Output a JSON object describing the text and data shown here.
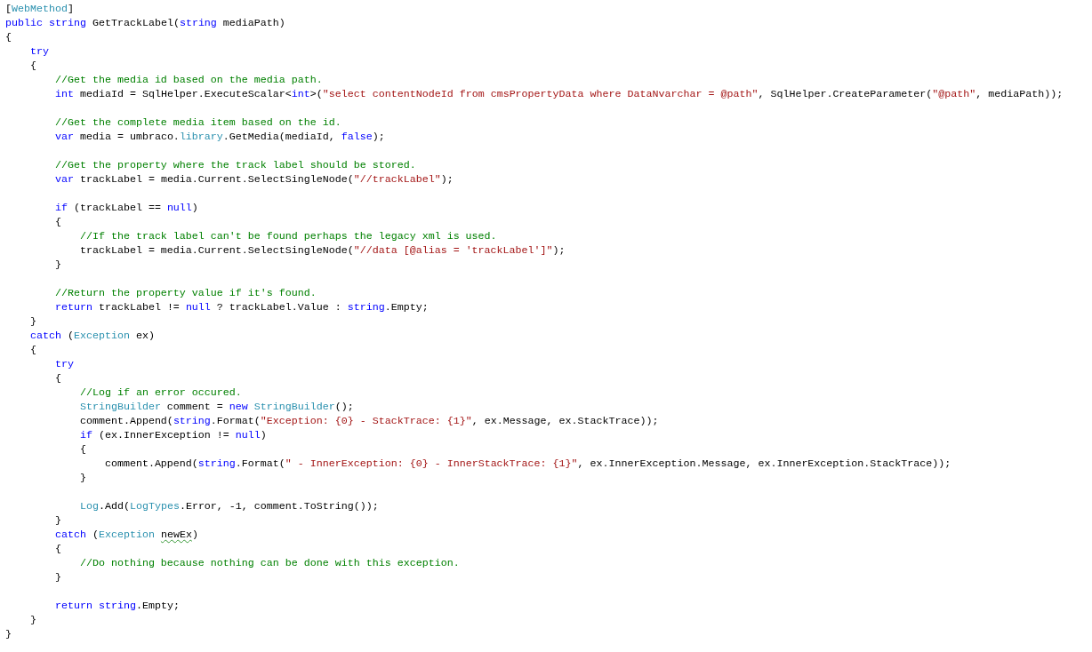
{
  "editor": {
    "lines": [
      {
        "kind": "code",
        "tokens": [
          {
            "text": "[",
            "kind": "plain"
          },
          {
            "text": "WebMethod",
            "kind": "type"
          },
          {
            "text": "]",
            "kind": "plain"
          }
        ]
      },
      {
        "kind": "code",
        "tokens": [
          {
            "text": "public",
            "kind": "keyword"
          },
          {
            "text": " string",
            "kind": "keyword"
          },
          {
            "text": " GetTrackLabel(",
            "kind": "plain"
          },
          {
            "text": "string",
            "kind": "keyword"
          },
          {
            "text": " mediaPath)",
            "kind": "plain"
          }
        ]
      },
      {
        "kind": "code",
        "tokens": [
          {
            "text": "{",
            "kind": "plain"
          }
        ]
      },
      {
        "kind": "code",
        "tokens": [
          {
            "text": "    try",
            "kind": "keyword"
          }
        ]
      },
      {
        "kind": "code",
        "tokens": [
          {
            "text": "    {",
            "kind": "plain"
          }
        ]
      },
      {
        "kind": "code",
        "tokens": [
          {
            "text": "        //Get the media id based on the media path.",
            "kind": "comment"
          }
        ]
      },
      {
        "kind": "code",
        "tokens": [
          {
            "text": "        int",
            "kind": "keyword"
          },
          {
            "text": " mediaId = SqlHelper.ExecuteScalar<",
            "kind": "plain"
          },
          {
            "text": "int",
            "kind": "keyword"
          },
          {
            "text": ">(",
            "kind": "plain"
          },
          {
            "text": "\"select contentNodeId from cmsPropertyData where DataNvarchar = @path\"",
            "kind": "string"
          },
          {
            "text": ", SqlHelper.CreateParameter(",
            "kind": "plain"
          },
          {
            "text": "\"@path\"",
            "kind": "string"
          },
          {
            "text": ", mediaPath));",
            "kind": "plain"
          }
        ]
      },
      {
        "kind": "blank"
      },
      {
        "kind": "code",
        "tokens": [
          {
            "text": "        //Get the complete media item based on the id.",
            "kind": "comment"
          }
        ]
      },
      {
        "kind": "code",
        "tokens": [
          {
            "text": "        var",
            "kind": "keyword"
          },
          {
            "text": " media = umbraco.",
            "kind": "plain"
          },
          {
            "text": "library",
            "kind": "type"
          },
          {
            "text": ".GetMedia(mediaId, ",
            "kind": "plain"
          },
          {
            "text": "false",
            "kind": "keyword"
          },
          {
            "text": ");",
            "kind": "plain"
          }
        ]
      },
      {
        "kind": "blank"
      },
      {
        "kind": "code",
        "tokens": [
          {
            "text": "        //Get the property where the track label should be stored.",
            "kind": "comment"
          }
        ]
      },
      {
        "kind": "code",
        "tokens": [
          {
            "text": "        var",
            "kind": "keyword"
          },
          {
            "text": " trackLabel = media.Current.SelectSingleNode(",
            "kind": "plain"
          },
          {
            "text": "\"//trackLabel\"",
            "kind": "string"
          },
          {
            "text": ");",
            "kind": "plain"
          }
        ]
      },
      {
        "kind": "blank"
      },
      {
        "kind": "code",
        "tokens": [
          {
            "text": "        if",
            "kind": "keyword"
          },
          {
            "text": " (trackLabel == ",
            "kind": "plain"
          },
          {
            "text": "null",
            "kind": "keyword"
          },
          {
            "text": ")",
            "kind": "plain"
          }
        ]
      },
      {
        "kind": "code",
        "tokens": [
          {
            "text": "        {",
            "kind": "plain"
          }
        ]
      },
      {
        "kind": "code",
        "tokens": [
          {
            "text": "            //If the track label can't be found perhaps the legacy xml is used.",
            "kind": "comment"
          }
        ]
      },
      {
        "kind": "code",
        "tokens": [
          {
            "text": "            trackLabel = media.Current.SelectSingleNode(",
            "kind": "plain"
          },
          {
            "text": "\"//data [@alias = 'trackLabel']\"",
            "kind": "string"
          },
          {
            "text": ");",
            "kind": "plain"
          }
        ]
      },
      {
        "kind": "code",
        "tokens": [
          {
            "text": "        }",
            "kind": "plain"
          }
        ]
      },
      {
        "kind": "blank"
      },
      {
        "kind": "code",
        "tokens": [
          {
            "text": "        //Return the property value if it's found.",
            "kind": "comment"
          }
        ]
      },
      {
        "kind": "code",
        "tokens": [
          {
            "text": "        return",
            "kind": "keyword"
          },
          {
            "text": " trackLabel != ",
            "kind": "plain"
          },
          {
            "text": "null",
            "kind": "keyword"
          },
          {
            "text": " ? trackLabel.Value : ",
            "kind": "plain"
          },
          {
            "text": "string",
            "kind": "keyword"
          },
          {
            "text": ".Empty;",
            "kind": "plain"
          }
        ]
      },
      {
        "kind": "code",
        "tokens": [
          {
            "text": "    }",
            "kind": "plain"
          }
        ]
      },
      {
        "kind": "code",
        "tokens": [
          {
            "text": "    catch",
            "kind": "keyword"
          },
          {
            "text": " (",
            "kind": "plain"
          },
          {
            "text": "Exception",
            "kind": "type"
          },
          {
            "text": " ex)",
            "kind": "plain"
          }
        ]
      },
      {
        "kind": "code",
        "tokens": [
          {
            "text": "    {",
            "kind": "plain"
          }
        ]
      },
      {
        "kind": "code",
        "tokens": [
          {
            "text": "        try",
            "kind": "keyword"
          }
        ]
      },
      {
        "kind": "code",
        "tokens": [
          {
            "text": "        {",
            "kind": "plain"
          }
        ]
      },
      {
        "kind": "code",
        "tokens": [
          {
            "text": "            //Log if an error occured.",
            "kind": "comment"
          }
        ]
      },
      {
        "kind": "code",
        "tokens": [
          {
            "text": "            StringBuilder",
            "kind": "type"
          },
          {
            "text": " comment = ",
            "kind": "plain"
          },
          {
            "text": "new",
            "kind": "keyword"
          },
          {
            "text": " StringBuilder",
            "kind": "type"
          },
          {
            "text": "();",
            "kind": "plain"
          }
        ]
      },
      {
        "kind": "code",
        "tokens": [
          {
            "text": "            comment.Append(",
            "kind": "plain"
          },
          {
            "text": "string",
            "kind": "keyword"
          },
          {
            "text": ".Format(",
            "kind": "plain"
          },
          {
            "text": "\"Exception: {0} - StackTrace: {1}\"",
            "kind": "string"
          },
          {
            "text": ", ex.Message, ex.StackTrace));",
            "kind": "plain"
          }
        ]
      },
      {
        "kind": "code",
        "tokens": [
          {
            "text": "            if",
            "kind": "keyword"
          },
          {
            "text": " (ex.InnerException != ",
            "kind": "plain"
          },
          {
            "text": "null",
            "kind": "keyword"
          },
          {
            "text": ")",
            "kind": "plain"
          }
        ]
      },
      {
        "kind": "code",
        "tokens": [
          {
            "text": "            {",
            "kind": "plain"
          }
        ]
      },
      {
        "kind": "code",
        "tokens": [
          {
            "text": "                comment.Append(",
            "kind": "plain"
          },
          {
            "text": "string",
            "kind": "keyword"
          },
          {
            "text": ".Format(",
            "kind": "plain"
          },
          {
            "text": "\" - InnerException: {0} - InnerStackTrace: {1}\"",
            "kind": "string"
          },
          {
            "text": ", ex.InnerException.Message, ex.InnerException.StackTrace));",
            "kind": "plain"
          }
        ]
      },
      {
        "kind": "code",
        "tokens": [
          {
            "text": "            }",
            "kind": "plain"
          }
        ]
      },
      {
        "kind": "blank"
      },
      {
        "kind": "code",
        "tokens": [
          {
            "text": "            Log",
            "kind": "type"
          },
          {
            "text": ".Add(",
            "kind": "plain"
          },
          {
            "text": "LogTypes",
            "kind": "type"
          },
          {
            "text": ".Error, -1, comment.ToString());",
            "kind": "plain"
          }
        ]
      },
      {
        "kind": "code",
        "tokens": [
          {
            "text": "        }",
            "kind": "plain"
          }
        ]
      },
      {
        "kind": "code",
        "tokens": [
          {
            "text": "        catch",
            "kind": "keyword"
          },
          {
            "text": " (",
            "kind": "plain"
          },
          {
            "text": "Exception",
            "kind": "type"
          },
          {
            "text": " newEx",
            "kind": "flagged"
          },
          {
            "text": ")",
            "kind": "plain"
          }
        ]
      },
      {
        "kind": "code",
        "tokens": [
          {
            "text": "        {",
            "kind": "plain"
          }
        ]
      },
      {
        "kind": "code",
        "tokens": [
          {
            "text": "            //Do nothing because nothing can be done with this exception.",
            "kind": "comment"
          }
        ]
      },
      {
        "kind": "code",
        "tokens": [
          {
            "text": "        }",
            "kind": "plain"
          }
        ]
      },
      {
        "kind": "blank"
      },
      {
        "kind": "code",
        "tokens": [
          {
            "text": "        return",
            "kind": "keyword"
          },
          {
            "text": " string",
            "kind": "keyword"
          },
          {
            "text": ".Empty;",
            "kind": "plain"
          }
        ]
      },
      {
        "kind": "code",
        "tokens": [
          {
            "text": "    }",
            "kind": "plain"
          }
        ]
      },
      {
        "kind": "code",
        "tokens": [
          {
            "text": "}",
            "kind": "plain"
          }
        ]
      }
    ]
  }
}
